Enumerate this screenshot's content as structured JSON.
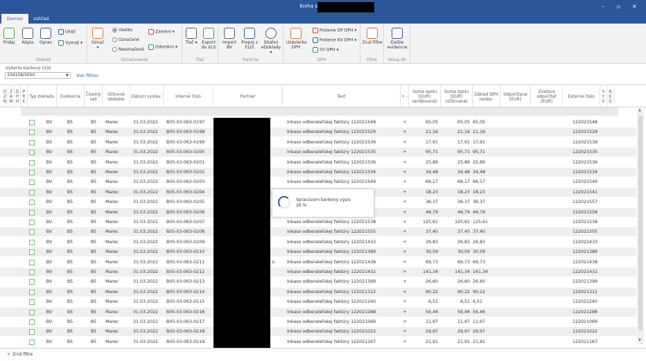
{
  "window": {
    "title": "Kniha účet v banke",
    "minimize": "–",
    "maximize": "▫",
    "close": "✕"
  },
  "tabs": [
    {
      "label": "Domov",
      "active": true
    },
    {
      "label": "Vzhľad",
      "active": false
    }
  ],
  "ribbon": {
    "doklad": {
      "label": "Doklad",
      "buttons": [
        "Pridaj",
        "Kópia",
        "Oprav"
      ],
      "ukaz": "Ukáž",
      "vymaz": "Vymaž"
    },
    "oznacovanie": {
      "label": "Označovanie",
      "oznac": "Označ",
      "options": [
        "Všetko",
        "Označené",
        "Neoznačené"
      ],
      "zamkni": "Zamkni",
      "odomkni": "Odomkni"
    },
    "tlac": {
      "label": "Tlač",
      "buttons": [
        "Tlač",
        "Export do XLS"
      ]
    },
    "funkcie": {
      "label": "Funkcie",
      "buttons": [
        "Import BV",
        "Prepoj s ELIS",
        "Stiahni eDoklady"
      ]
    },
    "dph": {
      "label": "DPH",
      "uzavierka": "Uzávierka DPH",
      "podanie_dp": "Podanie DP DPH",
      "podanie_kv": "Podanie KV DPH",
      "sv": "SV DPH"
    },
    "filtre": {
      "label": "Filtre",
      "zrus": "Zruš filtre"
    },
    "vstup": {
      "label": "Vstup do",
      "dalsie": "Ďalšie evidencie"
    }
  },
  "account": {
    "label": "Vyberte bankový účet",
    "value": "334158/3000",
    "more_filters": "Viac filtrov"
  },
  "columns": [
    {
      "key": "ozn",
      "label": "O Z N"
    },
    {
      "key": "zam",
      "label": "Z A M"
    },
    {
      "key": "dph",
      "label": "D P H"
    },
    {
      "key": "pre",
      "label": "P R E"
    },
    {
      "key": "typ",
      "label": "Typ dokladu"
    },
    {
      "key": "evidencia",
      "label": "Evidencia"
    },
    {
      "key": "rad",
      "label": "Číselný rad"
    },
    {
      "key": "obdobie",
      "label": "Účtovné obdobie"
    },
    {
      "key": "datum",
      "label": "Dátum vystav."
    },
    {
      "key": "interne",
      "label": "Interné číslo"
    },
    {
      "key": "partner",
      "label": "Partner"
    },
    {
      "key": "text",
      "label": "Text"
    },
    {
      "key": "znak",
      "label": "+ -"
    },
    {
      "key": "suma_ev",
      "label": "Suma spolu [EUR] (evidovaná)"
    },
    {
      "key": "suma_uc",
      "label": "Suma spolu [EUR] (účtovaná)"
    },
    {
      "key": "zaklad",
      "label": "Základ DPH neobs."
    },
    {
      "key": "odpocet",
      "label": "Odpočítané [EUR]"
    },
    {
      "key": "zostava",
      "label": "Zostáva odpočítať [EUR]"
    },
    {
      "key": "externe",
      "label": "Externé číslo"
    },
    {
      "key": "sys",
      "label": "S Y S"
    },
    {
      "key": "neu",
      "label": "N E Ú"
    }
  ],
  "rows": [
    {
      "typ": "BV",
      "ev": "B5",
      "rad": "B5",
      "obd": "Marec",
      "dat": "31.03.2022",
      "int": "B05-03-063-0197",
      "partner": "",
      "text": "Inkaso odberateľskej faktúry 122021548",
      "znak": "+",
      "s1": "65,05",
      "s2": "65,05",
      "s3": "65,05",
      "ext": "122021548"
    },
    {
      "typ": "BV",
      "ev": "B5",
      "rad": "B5",
      "obd": "Marec",
      "dat": "31.03.2022",
      "int": "B05-03-063-0198",
      "partner": "",
      "text": "Inkaso odberateľskej faktúry 122021529",
      "znak": "+",
      "s1": "21,16",
      "s2": "21,16",
      "s3": "21,16",
      "ext": "122021529"
    },
    {
      "typ": "BV",
      "ev": "B5",
      "rad": "B5",
      "obd": "Marec",
      "dat": "31.03.2022",
      "int": "B05-03-063-0199",
      "partner": "",
      "text": "Inkaso odberateľskej faktúry 122021539",
      "znak": "+",
      "s1": "17,91",
      "s2": "17,91",
      "s3": "17,91",
      "ext": "122021539"
    },
    {
      "typ": "BV",
      "ev": "B5",
      "rad": "B5",
      "obd": "Marec",
      "dat": "31.03.2022",
      "int": "B05-03-063-0200",
      "partner": "",
      "text": "Inkaso odberateľskej faktúry 122021535",
      "znak": "+",
      "s1": "95,71",
      "s2": "95,71",
      "s3": "95,71",
      "ext": "122021535"
    },
    {
      "typ": "BV",
      "ev": "B5",
      "rad": "B5",
      "obd": "Marec",
      "dat": "31.03.2022",
      "int": "B05-03-063-0201",
      "partner": "",
      "text": "Inkaso odberateľskej faktúry 122021536",
      "znak": "+",
      "s1": "25,89",
      "s2": "25,89",
      "s3": "25,89",
      "ext": "122021536"
    },
    {
      "typ": "BV",
      "ev": "B5",
      "rad": "B5",
      "obd": "Marec",
      "dat": "31.03.2022",
      "int": "B05-03-063-0202",
      "partner": "",
      "text": "Inkaso odberateľskej faktúry 122021534",
      "znak": "+",
      "s1": "34,48",
      "s2": "34,48",
      "s3": "34,48",
      "ext": "122021534"
    },
    {
      "typ": "BV",
      "ev": "B5",
      "rad": "B5",
      "obd": "Marec",
      "dat": "31.03.2022",
      "int": "B05-03-063-0203",
      "partner": "",
      "text": "Inkaso odberateľskej faktúry 122021549",
      "znak": "+",
      "s1": "66,17",
      "s2": "66,17",
      "s3": "66,17",
      "ext": "122021549"
    },
    {
      "typ": "BV",
      "ev": "B5",
      "rad": "B5",
      "obd": "Marec",
      "dat": "31.03.2022",
      "int": "B05-03-063-0204",
      "partner": "",
      "text": "",
      "znak": "+",
      "s1": "18,23",
      "s2": "18,23",
      "s3": "18,23",
      "ext": "122021541"
    },
    {
      "typ": "BV",
      "ev": "B5",
      "rad": "B5",
      "obd": "Marec",
      "dat": "31.03.2022",
      "int": "B05-03-063-0205",
      "partner": "",
      "text": "",
      "znak": "+",
      "s1": "36,37",
      "s2": "36,37",
      "s3": "36,37",
      "ext": "122021557"
    },
    {
      "typ": "BV",
      "ev": "B5",
      "rad": "B5",
      "obd": "Marec",
      "dat": "31.03.2022",
      "int": "B05-03-063-0206",
      "partner": "",
      "text": "",
      "znak": "+",
      "s1": "46,79",
      "s2": "46,79",
      "s3": "46,79",
      "ext": "122021558"
    },
    {
      "typ": "BV",
      "ev": "B5",
      "rad": "B5",
      "obd": "Marec",
      "dat": "31.03.2022",
      "int": "B05-03-063-0207",
      "partner": "",
      "text": "Inkaso odberateľskej faktúry 122021538",
      "znak": "+",
      "s1": "125,61",
      "s2": "125,61",
      "s3": "125,61",
      "ext": "122021538"
    },
    {
      "typ": "BV",
      "ev": "B5",
      "rad": "B5",
      "obd": "Marec",
      "dat": "31.03.2022",
      "int": "B05-03-063-0208",
      "partner": "",
      "text": "Inkaso odberateľskej faktúry 122021555",
      "znak": "+",
      "s1": "37,40",
      "s2": "37,40",
      "s3": "37,40",
      "ext": "122021555"
    },
    {
      "typ": "BV",
      "ev": "B5",
      "rad": "B5",
      "obd": "Marec",
      "dat": "31.03.2022",
      "int": "B05-03-063-0209",
      "partner": "",
      "text": "Inkaso odberateľskej faktúry 122021433",
      "znak": "+",
      "s1": "26,83",
      "s2": "26,83",
      "s3": "26,83",
      "ext": "122021433"
    },
    {
      "typ": "BV",
      "ev": "B5",
      "rad": "B5",
      "obd": "Marec",
      "dat": "31.03.2022",
      "int": "B05-03-063-0210",
      "partner": "",
      "text": "Inkaso odberateľskej faktúry 122021389",
      "znak": "+",
      "s1": "30,59",
      "s2": "30,59",
      "s3": "30,59",
      "ext": "122021389"
    },
    {
      "typ": "BV",
      "ev": "B5",
      "rad": "B5",
      "obd": "Marec",
      "dat": "31.03.2022",
      "int": "B05-03-063-0211",
      "partner": "o.",
      "text": "Inkaso odberateľskej faktúry 122021438",
      "znak": "+",
      "s1": "69,73",
      "s2": "69,73",
      "s3": "69,73",
      "ext": "122021438"
    },
    {
      "typ": "BV",
      "ev": "B5",
      "rad": "B5",
      "obd": "Marec",
      "dat": "31.03.2022",
      "int": "B05-03-063-0212",
      "partner": "",
      "text": "Inkaso odberateľskej faktúry 122021432",
      "znak": "+",
      "s1": "141,34",
      "s2": "141,34",
      "s3": "141,34",
      "ext": "122021432"
    },
    {
      "typ": "BV",
      "ev": "B5",
      "rad": "B5",
      "obd": "Marec",
      "dat": "31.03.2022",
      "int": "B05-03-063-0213",
      "partner": "",
      "text": "Inkaso odberateľskej faktúry 122021399",
      "znak": "+",
      "s1": "26,60",
      "s2": "26,60",
      "s3": "26,60",
      "ext": "122021399"
    },
    {
      "typ": "BV",
      "ev": "B5",
      "rad": "B5",
      "obd": "Marec",
      "dat": "31.03.2022",
      "int": "B05-03-063-0214",
      "partner": "",
      "text": "Inkaso odberateľskej faktúry 122021312",
      "znak": "+",
      "s1": "90,22",
      "s2": "90,22",
      "s3": "90,22",
      "ext": "122021312"
    },
    {
      "typ": "BV",
      "ev": "B5",
      "rad": "B5",
      "obd": "Marec",
      "dat": "31.03.2022",
      "int": "B05-03-063-0215",
      "partner": "",
      "text": "Inkaso odberateľskej faktúry 122021240",
      "znak": "+",
      "s1": "6,51",
      "s2": "6,51",
      "s3": "6,51",
      "ext": "122021240"
    },
    {
      "typ": "BV",
      "ev": "B5",
      "rad": "B5",
      "obd": "Marec",
      "dat": "31.03.2022",
      "int": "B05-03-063-0216",
      "partner": "",
      "text": "Inkaso odberateľskej faktúry 122021288",
      "znak": "+",
      "s1": "56,46",
      "s2": "56,46",
      "s3": "56,46",
      "ext": "122021288"
    },
    {
      "typ": "BV",
      "ev": "B5",
      "rad": "B5",
      "obd": "Marec",
      "dat": "31.03.2022",
      "int": "B05-03-063-0217",
      "partner": "",
      "text": "Inkaso odberateľskej faktúry 122021069",
      "znak": "+",
      "s1": "11,97",
      "s2": "11,97",
      "s3": "11,97",
      "ext": "122021069"
    },
    {
      "typ": "BV",
      "ev": "B5",
      "rad": "B5",
      "obd": "Marec",
      "dat": "31.03.2022",
      "int": "B05-03-063-0218",
      "partner": "",
      "text": "Inkaso odberateľskej faktúry 122021022",
      "znak": "+",
      "s1": "29,97",
      "s2": "29,97",
      "s3": "29,97",
      "ext": "122021022"
    },
    {
      "typ": "BV",
      "ev": "B5",
      "rad": "B5",
      "obd": "Marec",
      "dat": "31.03.2022",
      "int": "B05-03-063-0219",
      "partner": "",
      "text": "Inkaso odberateľskej faktúry 122021167",
      "znak": "+",
      "s1": "21,91",
      "s2": "21,91",
      "s3": "21,91",
      "ext": "122021167"
    }
  ],
  "progress": {
    "message": "Spracúvam bankový výpis",
    "percent": "26 %",
    "value": 0.26
  },
  "statusbar": {
    "clear_filters": "Zruš filtre"
  },
  "colors": {
    "accent": "#2b579a",
    "checkbox": "#6fbf6f"
  }
}
